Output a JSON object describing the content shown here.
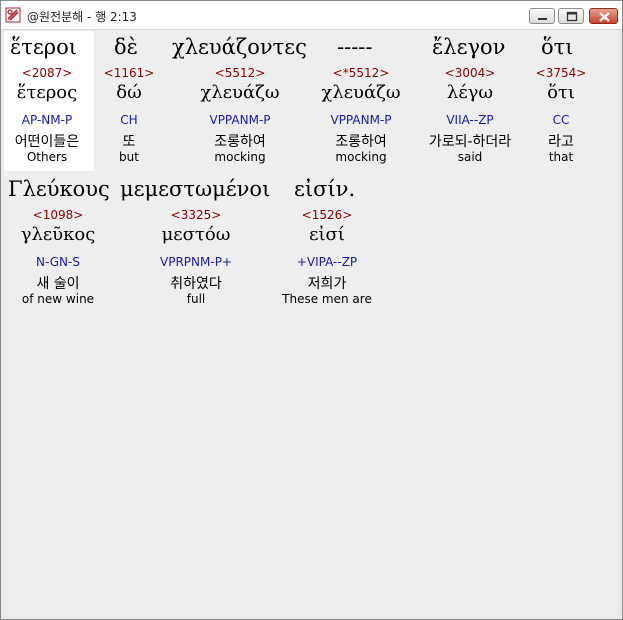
{
  "window": {
    "title": "@원전분해 - 행 2:13",
    "buttons": {
      "minimize": "minimize-icon",
      "maximize": "maximize-icon",
      "close": "close-icon"
    }
  },
  "row1": {
    "greek": [
      "ἕτεροι",
      "δὲ",
      "χλευάζοντες",
      "-----",
      "ἔλεγον",
      "ὅτι"
    ],
    "words": [
      {
        "strong": "<2087>",
        "lemma": "ἕτερος",
        "parse": "AP-NM-P",
        "korean": "어떤이들은",
        "english": "Others"
      },
      {
        "strong": "<1161>",
        "lemma": "δώ",
        "parse": "CH",
        "korean": "또",
        "english": "but"
      },
      {
        "strong": "<5512>",
        "lemma": "χλευάζω",
        "parse": "VPPANM-P",
        "korean": "조롱하여",
        "english": "mocking"
      },
      {
        "strong": "<*5512>",
        "lemma": "χλευάζω",
        "parse": "VPPANM-P",
        "korean": "조롱하여",
        "english": "mocking"
      },
      {
        "strong": "<3004>",
        "lemma": "λέγω",
        "parse": "VIIA--ZP",
        "korean": "가로되-하더라",
        "english": "said"
      },
      {
        "strong": "<3754>",
        "lemma": "ὅτι",
        "parse": "CC",
        "korean": "라고",
        "english": "that"
      }
    ]
  },
  "row2": {
    "greek": [
      "Γλεύκους",
      "μεμεστωμένοι",
      "εἰσίν."
    ],
    "words": [
      {
        "strong": "<1098>",
        "lemma": "γλεῦκος",
        "parse": "N-GN-S",
        "korean": "새 술이",
        "english": "of new wine"
      },
      {
        "strong": "<3325>",
        "lemma": "μεστόω",
        "parse": "VPRPNM-P+",
        "korean": "취하였다",
        "english": "full"
      },
      {
        "strong": "<1526>",
        "lemma": "εἰσί",
        "parse": "+VIPA--ZP",
        "korean": "저희가",
        "english": "These men are"
      }
    ]
  },
  "colors": {
    "strong": "#8b0000",
    "parse": "#1a1ab0",
    "highlight": "#ffffff"
  }
}
